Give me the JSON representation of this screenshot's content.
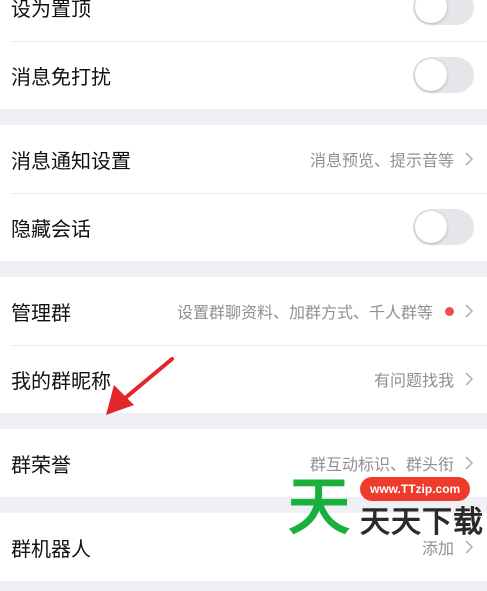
{
  "group1": {
    "pin_label": "设为置顶",
    "mute_label": "消息免打扰"
  },
  "group2": {
    "notify_label": "消息通知设置",
    "notify_hint": "消息预览、提示音等",
    "hide_label": "隐藏会话"
  },
  "group3": {
    "manage_label": "管理群",
    "manage_hint": "设置群聊资料、加群方式、千人群等",
    "nickname_label": "我的群昵称",
    "nickname_hint": "有问题找我"
  },
  "group4": {
    "honor_label": "群荣誉",
    "honor_hint": "群互动标识、群头衔"
  },
  "group5": {
    "robot_label": "群机器人",
    "robot_hint": "添加"
  },
  "watermark": {
    "big_char": "天",
    "url": "www.TTzip.com",
    "brand": "天天下载"
  },
  "colors": {
    "background": "#efeff4",
    "toggle_off": "#e6e6ea",
    "badge_red": "#ee4d58",
    "arrow_red": "#e3262a",
    "watermark_green": "#19b03c",
    "watermark_red": "#ee3b2c"
  }
}
